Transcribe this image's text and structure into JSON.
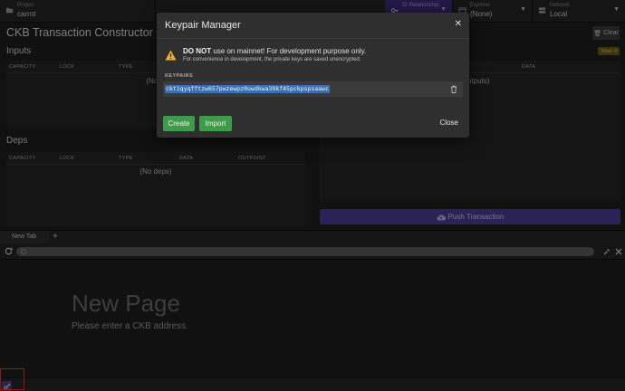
{
  "topbar": {
    "project": {
      "label": "Project",
      "value": "carrot"
    },
    "dropdown_purple": {
      "label": "ID Relationship",
      "value": ""
    },
    "explorer": {
      "label": "Explorer",
      "value": "(None)"
    },
    "network": {
      "label": "Network",
      "value": "Local"
    }
  },
  "constructor": {
    "title": "CKB Transaction Constructor",
    "clear_label": "Clear",
    "inputs": {
      "title": "Inputs",
      "columns": [
        "CAPACITY",
        "LOCK",
        "TYPE"
      ],
      "empty": "(No in"
    },
    "outputs": {
      "columns": [
        "DATA"
      ],
      "empty": "utputs)",
      "total_badge": "Total: 0"
    },
    "deps": {
      "title": "Deps",
      "columns": [
        "CAPACITY",
        "LOCK",
        "TYPE",
        "DATA",
        "OUTPOINT"
      ],
      "empty": "(No deps)"
    },
    "push_label": "Push Transaction"
  },
  "browser": {
    "tab_label": "New Tab",
    "new_tab_symbol": "+",
    "page_title": "New Page",
    "page_subtitle": "Please enter a CKB address."
  },
  "modal": {
    "title": "Keypair Manager",
    "warning_bold": "DO NOT",
    "warning_rest": " use on mainnet! For development purpose only.",
    "warning_sub": "For convenience in development, the private keys are saved unencrypted.",
    "keypairs_label": "KEYPAIRS",
    "keypairs": [
      "ckt1qyqfftzw657pwzewpz0uwdkwa39kf45pckpspsaawc"
    ],
    "create_label": "Create",
    "import_label": "Import",
    "close_label": "Close"
  },
  "colors": {
    "accent_purple": "#4b3d94",
    "create_green": "#3f9a4a",
    "selection_blue": "#3a6fb0",
    "warning_yellow": "#f0b429",
    "highlight_red": "#e0342a"
  }
}
